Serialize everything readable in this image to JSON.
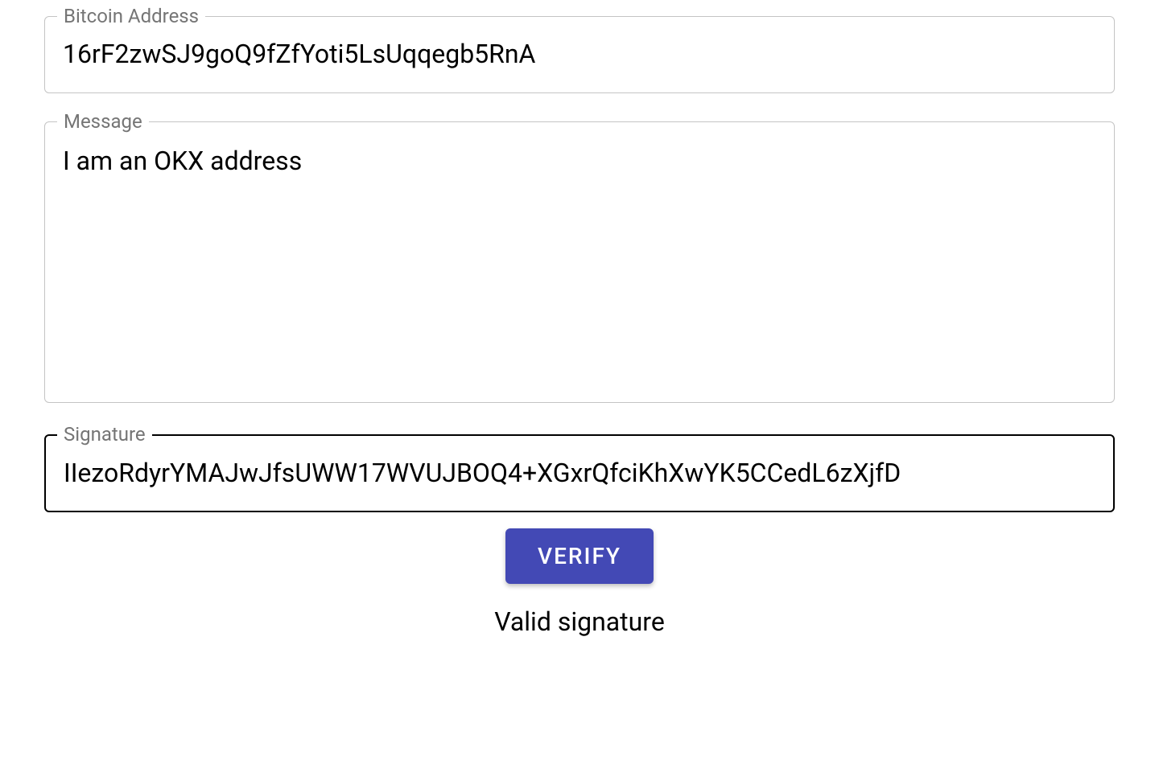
{
  "form": {
    "bitcoin_address": {
      "label": "Bitcoin Address",
      "value": "16rF2zwSJ9goQ9fZfYoti5LsUqqegb5RnA"
    },
    "message": {
      "label": "Message",
      "value": "I am an OKX address"
    },
    "signature": {
      "label": "Signature",
      "value": "IIezoRdyrYMAJwJfsUWW17WVUJBOQ4+XGxrQfciKhXwYK5CCedL6zXjfD"
    },
    "verify_button": "VERIFY",
    "result": "Valid signature"
  }
}
